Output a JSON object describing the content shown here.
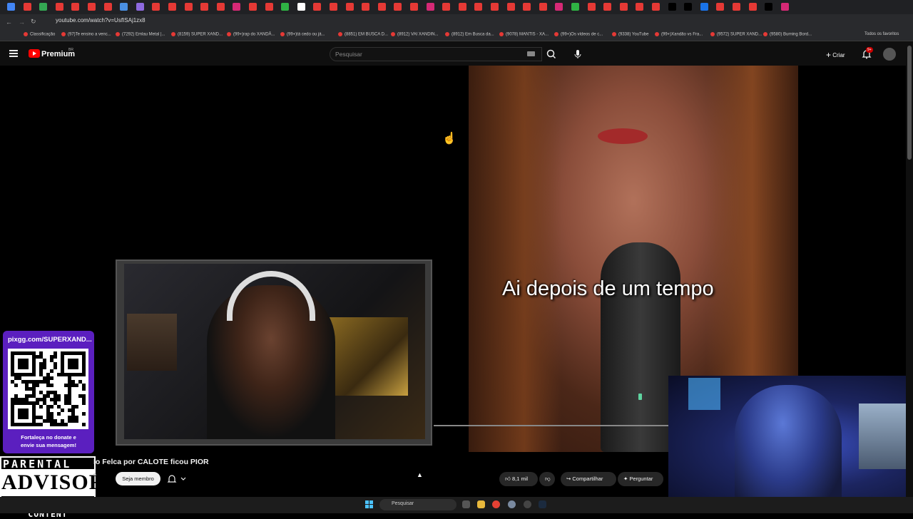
{
  "browser": {
    "url": "youtube.com/watch?v=UsfISAj1zx8",
    "bookmarks": [
      "Classificação",
      "(97)Te ensino a venc...",
      "(7292) Emlau Metal |...",
      "(8159) SUPER XAND...",
      "(99+)rap do XANDÃ...",
      "(99+)tá cedo ou já...",
      "(8851) EM BUSCA D...",
      "(8912) VAI XANDIN...",
      "(8912) Em Busca da...",
      "(9078) MANTIS - XA...",
      "(99+)Os vídeos de c...",
      "(9338) YouTube",
      "(99+)Xandão vs Fra...",
      "(9572) SUPER XAND...",
      "(9580) Burning Bord..."
    ],
    "all_bookmarks": "Todos os favoritos"
  },
  "header": {
    "brand": "Premium",
    "region": "BR",
    "search_placeholder": "Pesquisar",
    "create_label": "Criar",
    "notifications_badge": "9+"
  },
  "video": {
    "caption": "Ai depois de um tempo",
    "title": "lo Felca por CALOTE ficou PIOR",
    "channel_fragment": "o"
  },
  "overlay": {
    "pix_url": "pixgg.com/SUPERXAND...",
    "message_line1": "Fortaleça no donate e",
    "message_line2": "envie sua mensagem!",
    "advisory_top": "PARENTAL",
    "advisory_mid": "ADVISORY",
    "advisory_bottom": "EXPLICIT CONTENT"
  },
  "actions": {
    "join": "Seja membro",
    "likes": "8,1 mil",
    "share": "Compartilhar",
    "ask": "Perguntar"
  },
  "taskbar": {
    "search": "Pesquisar"
  },
  "colors": {
    "youtube_red": "#ff0000",
    "overlay_purple": "#5b1fbf",
    "background": "#0f0f0f"
  }
}
